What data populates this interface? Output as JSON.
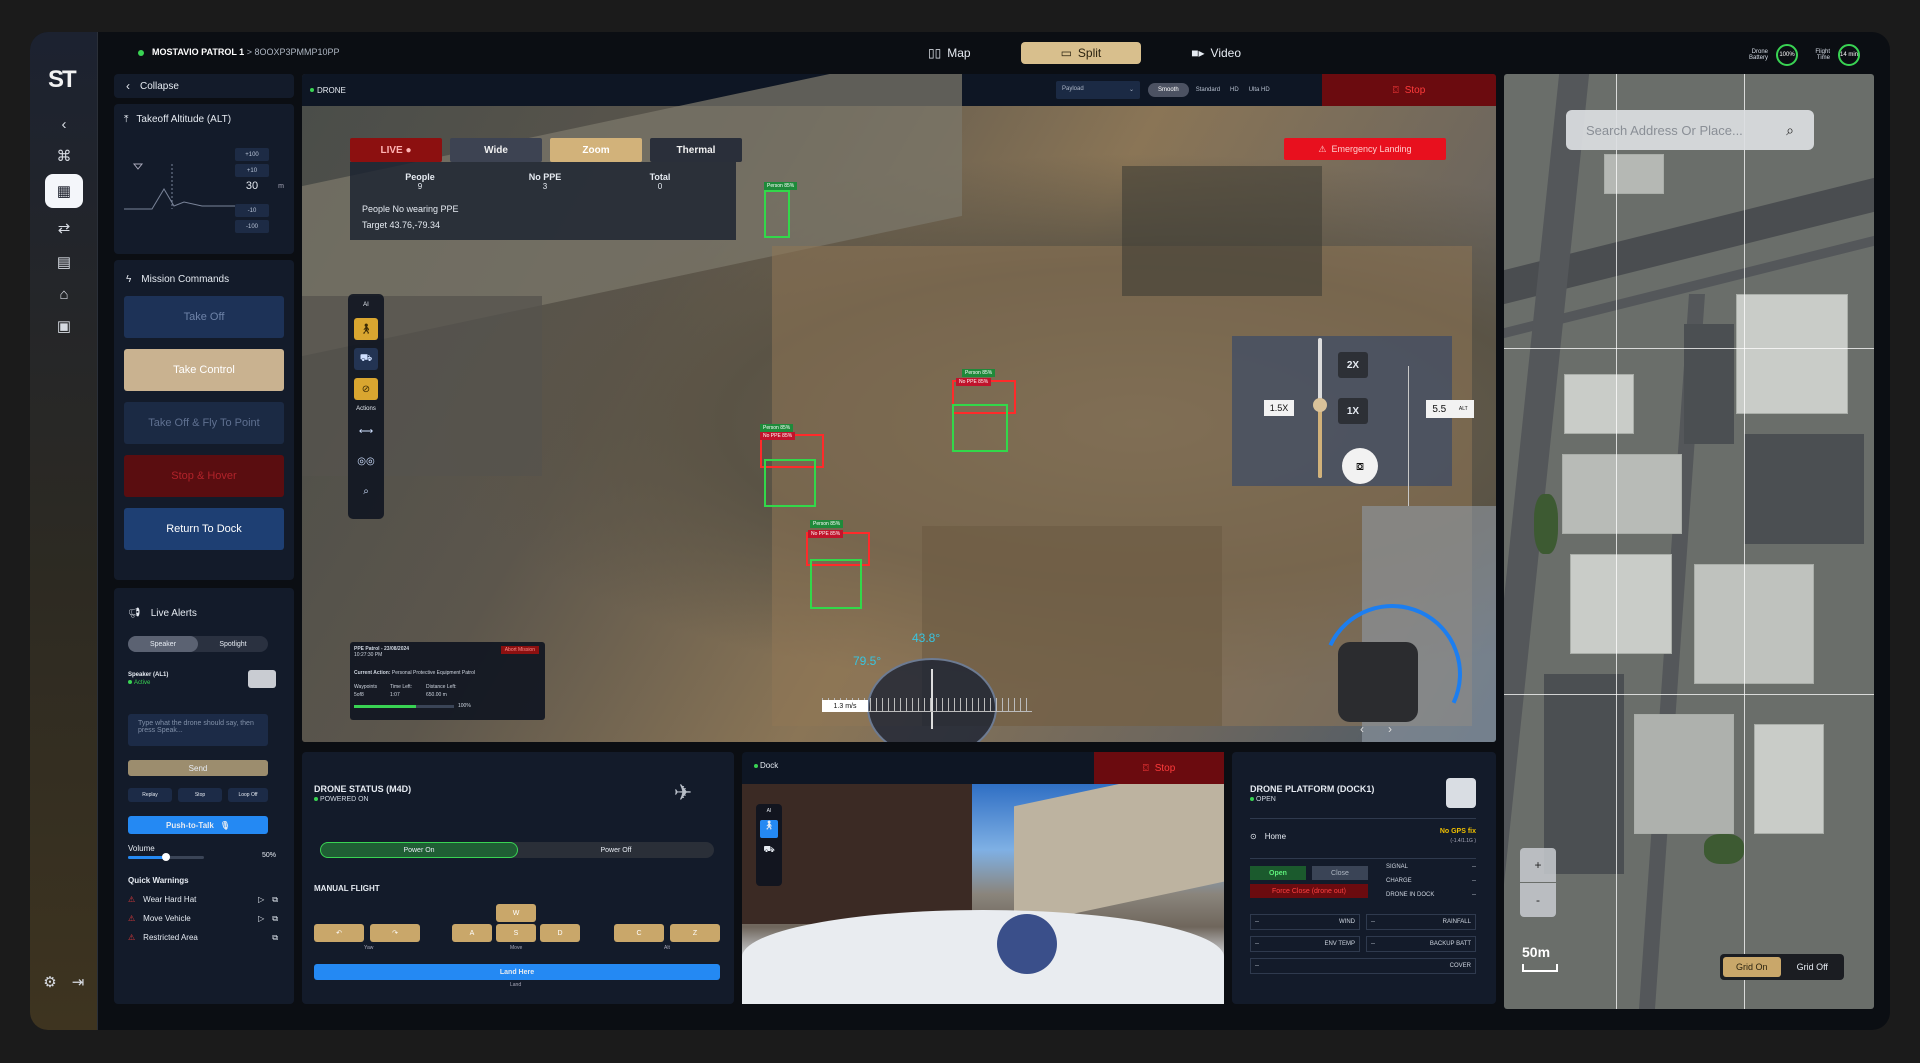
{
  "app": {
    "logo": "ST",
    "mission_name": "MOSTAVIO PATROL 1",
    "mission_id": "> 8OOXP3PMMP10PP"
  },
  "modes": [
    {
      "label": "Map",
      "icon": "map-icon",
      "active": false
    },
    {
      "label": "Split",
      "icon": "split-icon",
      "active": true
    },
    {
      "label": "Video",
      "icon": "video-icon",
      "active": false
    }
  ],
  "telemetry": {
    "battery_label": "Drone Battery",
    "battery_value": "100%",
    "flight_label": "Flight Time",
    "flight_value": "14 min"
  },
  "sidebar": {
    "collapse": "Collapse",
    "altitude_title": "Takeoff Altitude (ALT)",
    "altitude_value": "30",
    "altitude_unit": "m",
    "altitude_steps": [
      "+100",
      "+10",
      "-10",
      "-100"
    ],
    "mission_title": "Mission Commands",
    "commands": [
      "Take Off",
      "Take Control",
      "Take Off & Fly To Point",
      "Stop & Hover",
      "Return To Dock"
    ],
    "alerts_title": "Live Alerts",
    "alert_tabs": [
      "Speaker",
      "Spotlight"
    ],
    "speaker_name": "Speaker (AL1)",
    "speaker_status": "Active",
    "speak_placeholder": "Type what the drone should say, then press Speak...",
    "send": "Send",
    "playback": [
      "Replay",
      "Stop",
      "Loop Off"
    ],
    "ptt": "Push-to-Talk",
    "volume_label": "Volume",
    "volume_value": "50%",
    "volume_level": 0.5,
    "warnings_title": "Quick Warnings",
    "warnings": [
      "Wear Hard Hat",
      "Move Vehicle",
      "Restricted Area"
    ]
  },
  "video": {
    "source": "DRONE",
    "payload": "Payload",
    "quality": [
      "Smooth",
      "Standard",
      "HD",
      "Ulta HD"
    ],
    "stop": "Stop",
    "tabs": [
      "LIVE",
      "Wide",
      "Zoom",
      "Thermal"
    ],
    "stats": {
      "people_label": "People",
      "people_value": "9",
      "noppe_label": "No PPE",
      "noppe_value": "3",
      "total_label": "Total",
      "total_value": "0",
      "message": "People No wearing PPE",
      "target": "Target 43.76,-79.34"
    },
    "ai_label": "AI",
    "actions_label": "Actions",
    "emergency": "Emergency Landing",
    "zoom_levels": [
      "2X",
      "1X"
    ],
    "zoom_current": "1.5X",
    "alt_readout": "5.5",
    "alt_unit": "ALT",
    "heading_left": "79.5°",
    "heading_right": "43.8°",
    "speed": "1.3 m/s",
    "detections": [
      "Person 85%",
      "No PPE 85%",
      "Person 85%",
      "No PPE 85%",
      "Person 85%",
      "No PPE 85%"
    ],
    "mission": {
      "title": "PPE Patrol - 23/08/2024",
      "time": "10:27:30 PM",
      "abort": "Abort Mission",
      "action_label": "Current Action:",
      "action": "Personal Protective Equipment Patrol",
      "wp_label": "Waypoints",
      "wp": "5of8",
      "time_label": "Time Left:",
      "time_left": "1:07",
      "dist_label": "Distance Left:",
      "dist": "650.00 m",
      "progress_label": "100%",
      "progress": 0.62
    }
  },
  "drone_status": {
    "title": "DRONE STATUS (M4D)",
    "status": "POWERED ON",
    "power_on": "Power On",
    "power_off": "Power Off",
    "manual": "MANUAL FLIGHT",
    "keys": {
      "w": "W",
      "a": "A",
      "s": "S",
      "d": "D",
      "c": "C",
      "z": "Z"
    },
    "yaw": "Yaw",
    "move": "Move",
    "alt": "Alt",
    "land": "Land Here",
    "land_sub": "Land"
  },
  "dock_video": {
    "source": "Dock",
    "stop": "Stop",
    "ai": "AI"
  },
  "platform": {
    "title": "DRONE PLATFORM (DOCK1)",
    "state": "OPEN",
    "home": "Home",
    "gps": "No GPS fix",
    "gps_sub": "(-1.4/1.1G )",
    "open": "Open",
    "close": "Close",
    "force": "Force Close (drone out)",
    "signals": [
      {
        "k": "SIGNAL",
        "v": "--"
      },
      {
        "k": "CHARGE",
        "v": "--"
      },
      {
        "k": "DRONE IN DOCK",
        "v": "--"
      }
    ],
    "grid": [
      {
        "k": "WIND",
        "v": "--"
      },
      {
        "k": "RAINFALL",
        "v": "--"
      },
      {
        "k": "ENV TEMP",
        "v": "--"
      },
      {
        "k": "BACKUP BATT",
        "v": "--"
      },
      {
        "k": "COVER",
        "v": "--"
      }
    ]
  },
  "map": {
    "search_placeholder": "Search Address Or Place...",
    "scale": "50m",
    "grid_on": "Grid On",
    "grid_off": "Grid Off",
    "zoom_in": "+",
    "zoom_out": "-"
  }
}
